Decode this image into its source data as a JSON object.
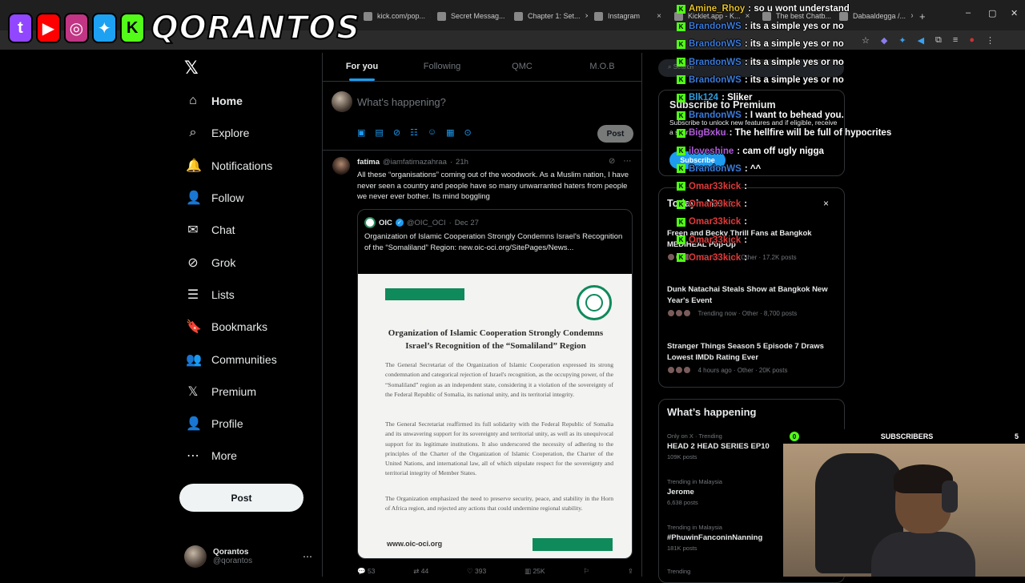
{
  "browser": {
    "tabs": [
      {
        "label": "kick.com/pop..."
      },
      {
        "label": "Secret Messag..."
      },
      {
        "label": "Chapter 1: Set..."
      },
      {
        "label": "Instagram"
      },
      {
        "label": "Kicklet.app - K..."
      },
      {
        "label": "The best Chatb..."
      },
      {
        "label": "Dabaaldegga /..."
      }
    ],
    "new_tab": "+"
  },
  "overlay": {
    "brand": "QORANTOS",
    "social_icons": [
      "twitch-icon",
      "youtube-icon",
      "instagram-icon",
      "twitter-icon",
      "kick-icon"
    ],
    "colors": {
      "twitch": "#9146ff",
      "youtube": "#ff0000",
      "instagram": "#c13584",
      "twitter": "#1da1f2",
      "kick": "#53fc18"
    }
  },
  "nav": {
    "items": [
      {
        "label": "Home",
        "icon": "home-icon",
        "glyph": "⌂"
      },
      {
        "label": "Explore",
        "icon": "search-icon",
        "glyph": "⌕"
      },
      {
        "label": "Notifications",
        "icon": "bell-icon",
        "glyph": "🔔"
      },
      {
        "label": "Follow",
        "icon": "add-person-icon",
        "glyph": "👤"
      },
      {
        "label": "Chat",
        "icon": "mail-icon",
        "glyph": "✉"
      },
      {
        "label": "Grok",
        "icon": "grok-icon",
        "glyph": "⊘"
      },
      {
        "label": "Lists",
        "icon": "list-icon",
        "glyph": "☰"
      },
      {
        "label": "Bookmarks",
        "icon": "bookmark-icon",
        "glyph": "🔖"
      },
      {
        "label": "Communities",
        "icon": "communities-icon",
        "glyph": "👥"
      },
      {
        "label": "Premium",
        "icon": "x-icon",
        "glyph": "𝕏"
      },
      {
        "label": "Profile",
        "icon": "profile-icon",
        "glyph": "👤"
      },
      {
        "label": "More",
        "icon": "more-circle-icon",
        "glyph": "⋯"
      }
    ],
    "post_label": "Post",
    "account": {
      "name": "Qorantos",
      "handle": "@qorantos"
    }
  },
  "feed": {
    "tabs": [
      "For you",
      "Following",
      "QMC",
      "M.O.B"
    ],
    "compose_placeholder": "What's happening?",
    "post_label": "Post",
    "tweet": {
      "name": "fatima",
      "handle": "@iamfatimazahraa",
      "time": "21h",
      "text": "All these “organisations” coming out of the woodwork. As a Muslim nation, I have never seen a country and people have so many unwarranted haters from people we never ever bother. Its mind boggling",
      "quote": {
        "name": "OIC",
        "handle": "@OIC_OCI",
        "time": "Dec 27",
        "text": "Organization of Islamic Cooperation Strongly Condemns Israel's Recognition of the “Somaliland” Region: new.oic-oci.org/SitePages/News..."
      },
      "document": {
        "title": "Organization of Islamic Cooperation Strongly Condemns Israel’s Recognition of the “Somaliland” Region",
        "paragraphs": [
          "The General Secretariat of the Organization of Islamic Cooperation expressed its strong condemnation and categorical rejection of Israel's recognition, as the occupying power, of the “Somaliland” region as an independent state, considering it a violation of the sovereignty of the Federal Republic of Somalia, its national unity, and its territorial integrity.",
          "The General Secretariat reaffirmed its full solidarity with the Federal Republic of Somalia and its unwavering support for its sovereignty and territorial unity, as well as its unequivocal support for its legitimate institutions. It also underscored the necessity of adhering to the principles of the Charter of the Organization of Islamic Cooperation, the Charter of the United Nations, and international law, all of which stipulate respect for the sovereignty and territorial integrity of Member States.",
          "The Organization emphasized the need to preserve security, peace, and stability in the Horn of Africa region, and rejected any actions that could undermine regional stability."
        ],
        "url": "www.oic-oci.org"
      },
      "stats": {
        "replies": "53",
        "reposts": "44",
        "likes": "393",
        "views": "25K"
      }
    }
  },
  "sidebar": {
    "search_placeholder": "Search",
    "premium": {
      "title": "Subscribe to Premium",
      "text": "Subscribe to unlock new features and if eligible, receive a share of revenue.",
      "button": "Subscribe"
    },
    "news": {
      "title": "Today’s News",
      "close": "×",
      "items": [
        {
          "title": "Freen and Becky Thrill Fans at Bangkok MEDIHEAL Pop-Up",
          "meta": "12 hours ago · Other · 17.2K posts"
        },
        {
          "title": "Dunk Natachai Steals Show at Bangkok New Year's Event",
          "meta": "Trending now · Other · 8,700 posts"
        },
        {
          "title": "Stranger Things Season 5 Episode 7 Draws Lowest IMDb Rating Ever",
          "meta": "4 hours ago · Other · 20K posts"
        }
      ]
    },
    "happening": {
      "title": "What’s happening",
      "trends": [
        {
          "context": "Only on X · Trending",
          "name": "HEAD 2 HEAD SERIES EP10",
          "count": "109K posts"
        },
        {
          "context": "Trending in Malaysia",
          "name": "Jerome",
          "count": "6,638 posts"
        },
        {
          "context": "Trending in Malaysia",
          "name": "#PhuwinFanconinNanning",
          "count": "181K posts"
        },
        {
          "context": "Trending",
          "name": "",
          "count": ""
        }
      ]
    }
  },
  "chat": {
    "messages": [
      {
        "user": "Amine_Rhoy",
        "msg": ": so u wont understand",
        "color": "#e6c229"
      },
      {
        "user": "BrandonWS",
        "msg": ": its a simple yes or no",
        "color": "#3b7ad9"
      },
      {
        "user": "BrandonWS",
        "msg": ": its a simple yes or no",
        "color": "#3b7ad9"
      },
      {
        "user": "BrandonWS",
        "msg": ": its a simple yes or no",
        "color": "#3b7ad9"
      },
      {
        "user": "BrandonWS",
        "msg": ": its a simple yes or no",
        "color": "#3b7ad9"
      },
      {
        "user": "Blk124",
        "msg": ": Sliker",
        "color": "#2e9cdb"
      },
      {
        "user": "BrandonWS",
        "msg": ": I want to behead you.",
        "color": "#3b7ad9"
      },
      {
        "user": "BigBxku",
        "msg": ": The hellfire will be full of hypocrites",
        "color": "#b05bdb"
      },
      {
        "user": "iloveshine",
        "msg": ": cam off ugly nigga",
        "color": "#b05bdb"
      },
      {
        "user": "BrandonWS",
        "msg": ": ^^",
        "color": "#3b7ad9"
      },
      {
        "user": "Omar33kick",
        "msg": ":",
        "color": "#e03a3a"
      },
      {
        "user": "Omar33kick",
        "msg": ":",
        "color": "#e03a3a"
      },
      {
        "user": "Omar33kick",
        "msg": ":",
        "color": "#e03a3a"
      },
      {
        "user": "Omar33kick",
        "msg": ":",
        "color": "#e03a3a"
      },
      {
        "user": "Omar33kick",
        "msg": ":",
        "color": "#e03a3a"
      }
    ]
  },
  "webcam": {
    "label": "SUBSCRIBERS",
    "left_count": "0",
    "right_count": "5"
  }
}
